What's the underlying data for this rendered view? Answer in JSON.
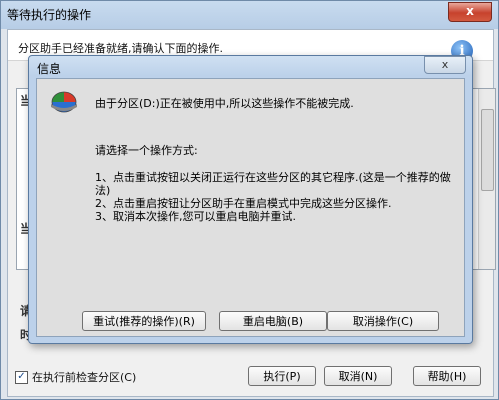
{
  "window": {
    "title": "等待执行的操作",
    "close_symbol": "x",
    "info_text": "分区助手已经准备就绪,请确认下面的操作.",
    "info_icon": "i",
    "side_chars": [
      "当",
      "当",
      "请",
      "时"
    ]
  },
  "footer": {
    "check_label": "在执行前检查分区(C)",
    "check_mark": "✓",
    "execute": "执行(P)",
    "cancel": "取消(N)",
    "help": "帮助(H)"
  },
  "dialog": {
    "title": "信息",
    "close_symbol": "x",
    "message": "由于分区(D:)正在被使用中,所以这些操作不能被完成.",
    "choose": "请选择一个操作方式:",
    "option1_line1": "1、点击重试按钮以关闭正运行在这些分区的其它程序.(这是一个推荐的做",
    "option1_line2": "法)",
    "option2": "2、点击重启按钮让分区助手在重启模式中完成这些分区操作.",
    "option3": "3、取消本次操作,您可以重启电脑并重试.",
    "retry": "重试(推荐的操作)(R)",
    "restart": "重启电脑(B)",
    "cancel_op": "取消操作(C)"
  },
  "colors": {
    "accent": "#1e5fb8",
    "close_red": "#c7422d"
  }
}
